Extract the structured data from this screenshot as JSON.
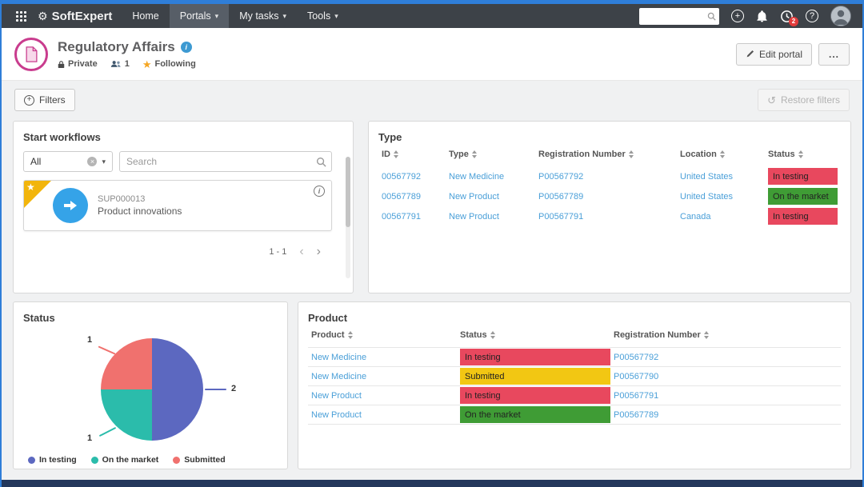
{
  "colors": {
    "status_red": "#e8485e",
    "status_green": "#3f9c35",
    "status_yellow": "#f2c713",
    "link_blue": "#4a9fd8",
    "workflow_icon_blue": "#35a3e8",
    "ribbon_yellow": "#f2b50c"
  },
  "navbar": {
    "brand": "SoftExpert",
    "menu": [
      {
        "label": "Home"
      },
      {
        "label": "Portals"
      },
      {
        "label": "My tasks"
      },
      {
        "label": "Tools"
      }
    ],
    "search_placeholder": "",
    "notification_badge": "2"
  },
  "header": {
    "title": "Regulatory Affairs",
    "privacy_label": "Private",
    "members_count": "1",
    "following_label": "Following",
    "edit_portal_label": "Edit portal",
    "more_label": "..."
  },
  "filter_bar": {
    "filters_label": "Filters",
    "restore_filters_label": "Restore filters"
  },
  "start_workflows": {
    "title": "Start workflows",
    "filter_value": "All",
    "search_placeholder": "Search",
    "workflow": {
      "id": "SUP000013",
      "name": "Product innovations"
    },
    "pagination": "1 - 1"
  },
  "type_table": {
    "title": "Type",
    "columns": [
      "ID",
      "Type",
      "Registration Number",
      "Location",
      "Status"
    ],
    "rows": [
      {
        "id": "00567792",
        "type": "New Medicine",
        "registration_number": "P00567792",
        "location": "United States",
        "status": "In testing",
        "status_color": "#e8485e"
      },
      {
        "id": "00567789",
        "type": "New Product",
        "registration_number": "P00567789",
        "location": "United States",
        "status": "On the market",
        "status_color": "#3f9c35"
      },
      {
        "id": "00567791",
        "type": "New Product",
        "registration_number": "P00567791",
        "location": "Canada",
        "status": "In testing",
        "status_color": "#e8485e"
      }
    ]
  },
  "status_card": {
    "title": "Status",
    "chart_data": {
      "type": "pie",
      "labels": [
        "In testing",
        "On the market",
        "Submitted"
      ],
      "values": [
        2,
        1,
        1
      ],
      "colors": [
        "#5c68c0",
        "#2bbcab",
        "#f0716e"
      ],
      "legend_position": "bottom"
    }
  },
  "product_table": {
    "title": "Product",
    "columns": [
      "Product",
      "Status",
      "Registration Number"
    ],
    "rows": [
      {
        "product": "New Medicine",
        "status": "In testing",
        "status_color": "#e8485e",
        "registration_number": "P00567792"
      },
      {
        "product": "New Medicine",
        "status": "Submitted",
        "status_color": "#f2c713",
        "registration_number": "P00567790"
      },
      {
        "product": "New Product",
        "status": "In testing",
        "status_color": "#e8485e",
        "registration_number": "P00567791"
      },
      {
        "product": "New Product",
        "status": "On the market",
        "status_color": "#3f9c35",
        "registration_number": "P00567789"
      }
    ]
  }
}
